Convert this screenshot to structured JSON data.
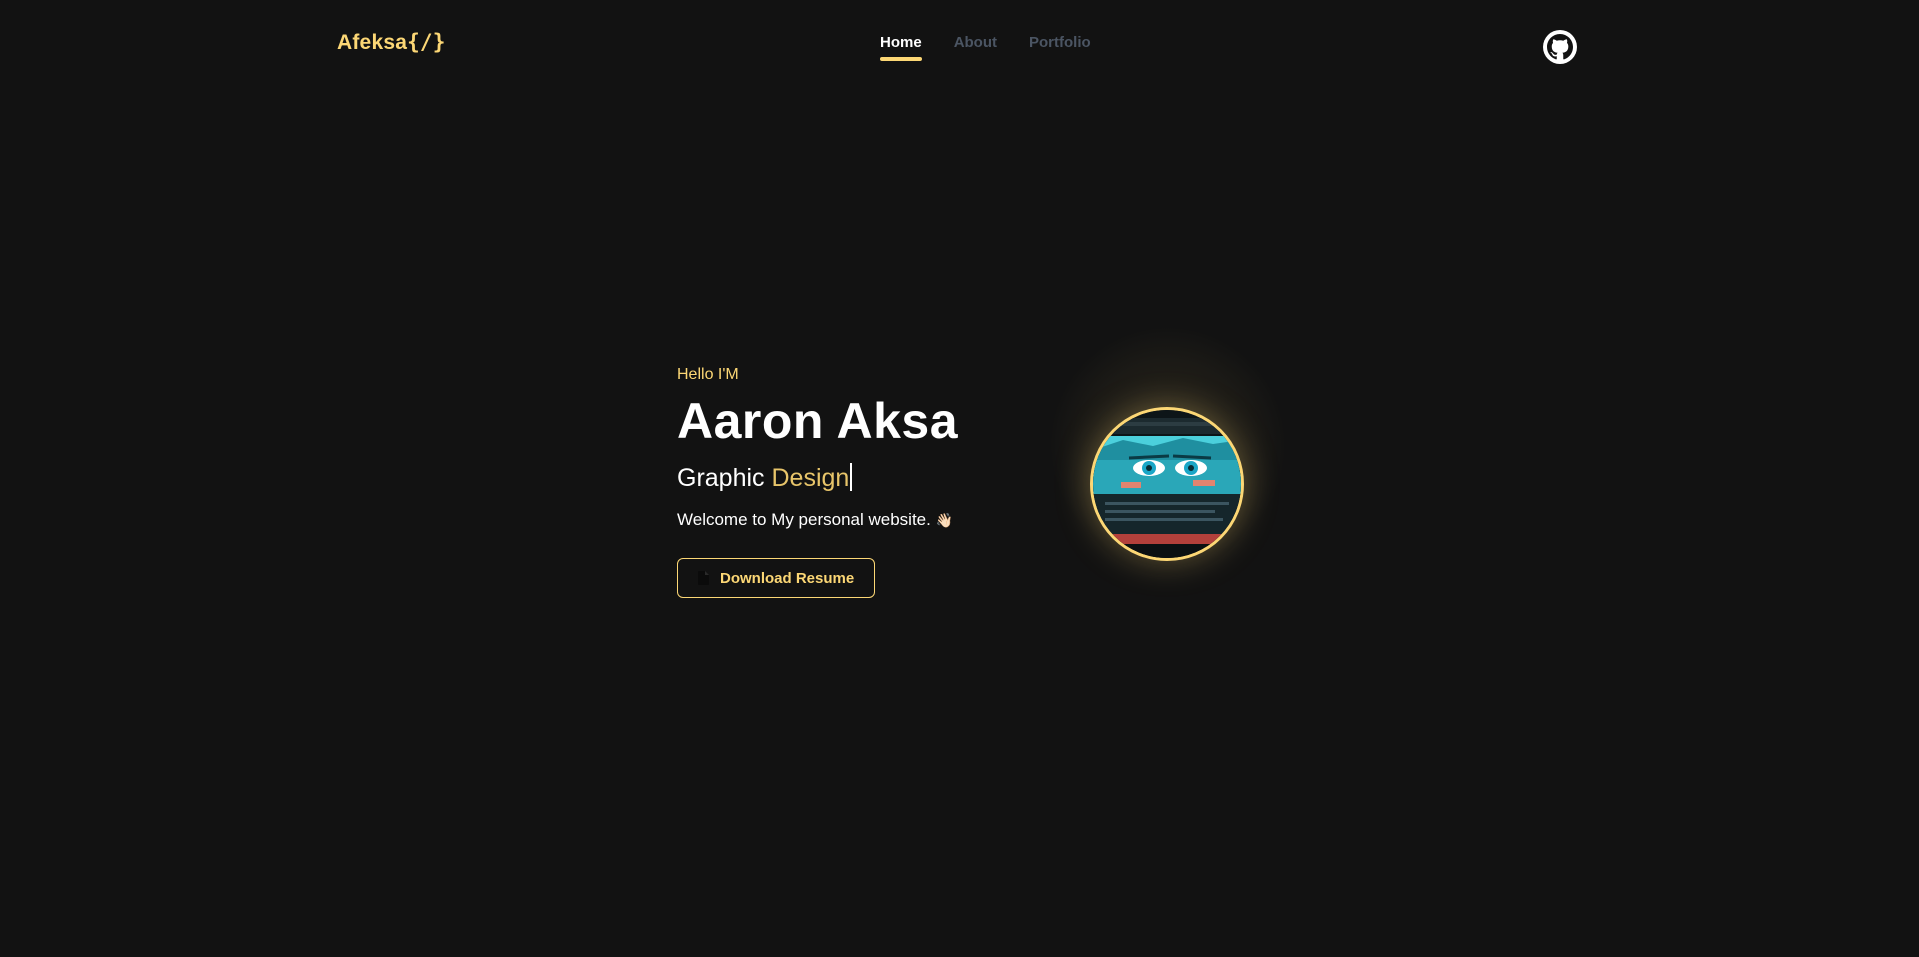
{
  "navbar": {
    "logo_text": "Afeksa",
    "logo_brace": "{/}",
    "links": [
      {
        "label": "Home",
        "active": true
      },
      {
        "label": "About",
        "active": false
      },
      {
        "label": "Portfolio",
        "active": false
      }
    ],
    "github_icon": "github-icon"
  },
  "hero": {
    "greeting": "Hello I'M",
    "name": "Aaron Aksa",
    "role_prefix": "Graphic",
    "role_accent": "Design",
    "welcome": "Welcome to My personal website.",
    "welcome_emoji": "👋🏻",
    "download_label": "Download Resume",
    "download_icon": "file-icon"
  },
  "colors": {
    "background": "#121212",
    "accent": "#fcd775",
    "nav_inactive": "#4b5563",
    "text": "#ffffff"
  }
}
